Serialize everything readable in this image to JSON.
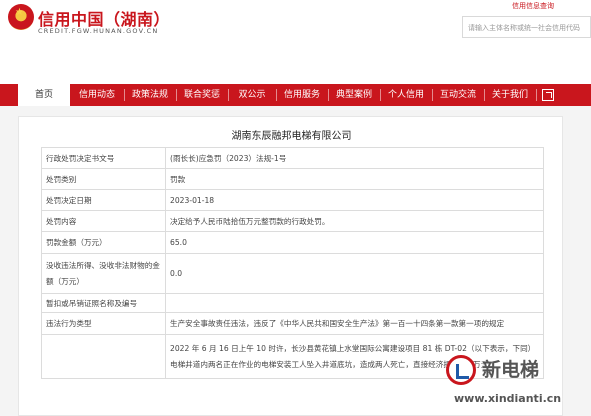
{
  "header": {
    "title": "信用中国（湖南）",
    "domain": "CREDIT.FGW.HUNAN.GOV.CN",
    "top_link": "信用信息查询",
    "search_placeholder": "请输入主体名称或统一社会信用代码"
  },
  "nav": {
    "items": [
      "首页",
      "信用动态",
      "政策法规",
      "联合奖惩",
      "双公示",
      "信用服务",
      "典型案例",
      "个人信用",
      "互动交流",
      "关于我们"
    ],
    "active_index": 0,
    "colors": {
      "bar": "#c9161d",
      "active_bg": "#ffffff"
    }
  },
  "detail": {
    "company": "湖南东辰融邦电梯有限公司",
    "rows": [
      {
        "label": "行政处罚决定书文号",
        "value": "(雨长长)应急罚（2023）法规-1号"
      },
      {
        "label": "处罚类别",
        "value": "罚款"
      },
      {
        "label": "处罚决定日期",
        "value": "2023-01-18"
      },
      {
        "label": "处罚内容",
        "value": "决定给予人民币陆拾伍万元整罚款的行政处罚。"
      },
      {
        "label": "罚款金额（万元）",
        "value": "65.0"
      },
      {
        "label": "没收违法所得、没收非法财物的金额（万元）",
        "value": "0.0"
      },
      {
        "label": "暂扣或吊销证照名称及编号",
        "value": ""
      },
      {
        "label": "违法行为类型",
        "value": "生产安全事故责任违法，违反了《中华人民共和国安全生产法》第一百一十四条第一款第一项的规定"
      },
      {
        "label": "",
        "value": "2022 年 6 月 16 日上午 10 时许，长沙县黄花镇上水堂国际公寓建设项目 81 栋 DT-02（以下表示，下同）电梯井道内两名正在作业的电梯安装工人坠入井道底坑，造成两人死亡，直接经济损失 3.. 万元"
      }
    ]
  },
  "watermark": {
    "name": "新电梯",
    "url": "www.xindianti.cn"
  }
}
